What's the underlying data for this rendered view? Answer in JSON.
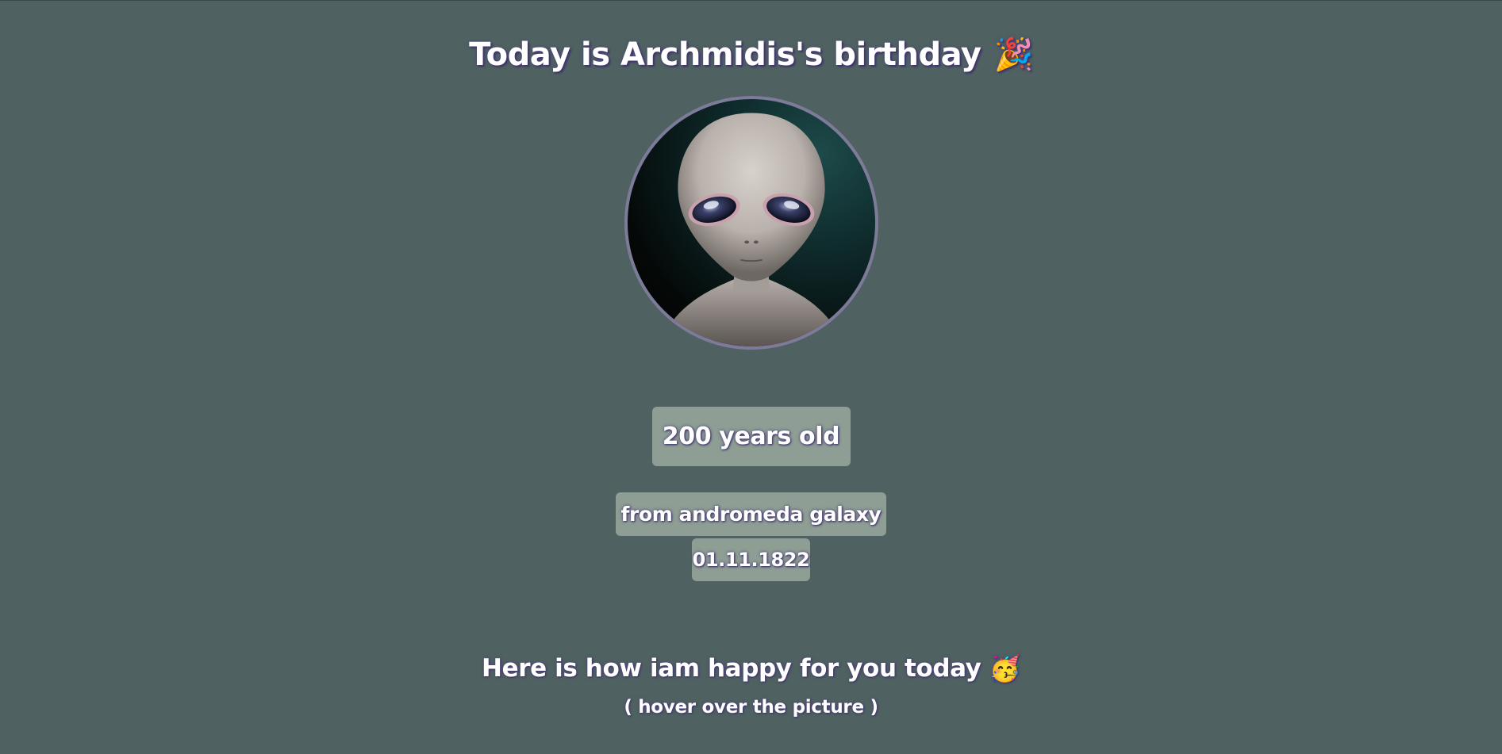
{
  "header": {
    "title": "Today is Archmidis's birthday",
    "title_emoji": "🎉"
  },
  "portrait": {
    "icon": "alien-portrait",
    "border_color": "#7e7a99"
  },
  "info": {
    "age": "200 years old",
    "origin": "from andromeda galaxy",
    "date": "01.11.1822"
  },
  "message": {
    "text": "Here is how iam happy for you today",
    "emoji": "🥳",
    "hint": "( hover over the picture )"
  },
  "colors": {
    "background": "#4f6261",
    "badge": "#8e9e94",
    "text": "#ffffff",
    "text_shadow": "#3a2f66"
  }
}
